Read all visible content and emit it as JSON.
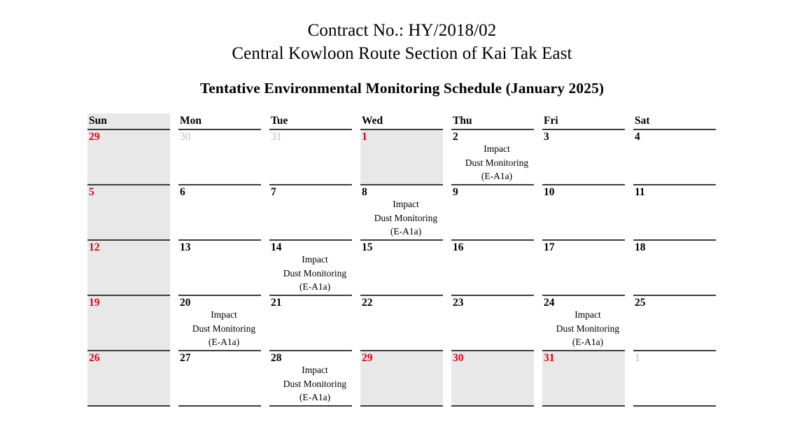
{
  "header": {
    "contract_line": "Contract No.: HY/2018/02",
    "project_line": "Central Kowloon Route Section of Kai Tak East",
    "schedule_title": "Tentative Environmental Monitoring Schedule (January 2025)"
  },
  "colors": {
    "holiday_red": "#e60012",
    "outside_month_gray": "#bdbdbd",
    "shaded_cell": "#e8e8e8",
    "border_dark": "#3b3b3b"
  },
  "calendar": {
    "month_label": "January 2025",
    "daynames": [
      "Sun",
      "Mon",
      "Tue",
      "Wed",
      "Thu",
      "Fri",
      "Sat"
    ],
    "event_label": {
      "line1": "Impact",
      "line2": "Dust Monitoring",
      "line3": "(E-A1a)"
    },
    "weeks": [
      [
        {
          "date": "29",
          "style": "holiday",
          "shaded": true,
          "event": false
        },
        {
          "date": "30",
          "style": "outside",
          "shaded": false,
          "event": false
        },
        {
          "date": "31",
          "style": "outside",
          "shaded": false,
          "event": false
        },
        {
          "date": "1",
          "style": "holiday",
          "shaded": true,
          "event": false
        },
        {
          "date": "2",
          "style": "normal",
          "shaded": false,
          "event": true
        },
        {
          "date": "3",
          "style": "normal",
          "shaded": false,
          "event": false
        },
        {
          "date": "4",
          "style": "normal",
          "shaded": false,
          "event": false
        }
      ],
      [
        {
          "date": "5",
          "style": "holiday",
          "shaded": true,
          "event": false
        },
        {
          "date": "6",
          "style": "normal",
          "shaded": false,
          "event": false
        },
        {
          "date": "7",
          "style": "normal",
          "shaded": false,
          "event": false
        },
        {
          "date": "8",
          "style": "normal",
          "shaded": false,
          "event": true
        },
        {
          "date": "9",
          "style": "normal",
          "shaded": false,
          "event": false
        },
        {
          "date": "10",
          "style": "normal",
          "shaded": false,
          "event": false
        },
        {
          "date": "11",
          "style": "normal",
          "shaded": false,
          "event": false
        }
      ],
      [
        {
          "date": "12",
          "style": "holiday",
          "shaded": true,
          "event": false
        },
        {
          "date": "13",
          "style": "normal",
          "shaded": false,
          "event": false
        },
        {
          "date": "14",
          "style": "normal",
          "shaded": false,
          "event": true
        },
        {
          "date": "15",
          "style": "normal",
          "shaded": false,
          "event": false
        },
        {
          "date": "16",
          "style": "normal",
          "shaded": false,
          "event": false
        },
        {
          "date": "17",
          "style": "normal",
          "shaded": false,
          "event": false
        },
        {
          "date": "18",
          "style": "normal",
          "shaded": false,
          "event": false
        }
      ],
      [
        {
          "date": "19",
          "style": "holiday",
          "shaded": true,
          "event": false
        },
        {
          "date": "20",
          "style": "normal",
          "shaded": false,
          "event": true
        },
        {
          "date": "21",
          "style": "normal",
          "shaded": false,
          "event": false
        },
        {
          "date": "22",
          "style": "normal",
          "shaded": false,
          "event": false
        },
        {
          "date": "23",
          "style": "normal",
          "shaded": false,
          "event": false
        },
        {
          "date": "24",
          "style": "normal",
          "shaded": false,
          "event": true
        },
        {
          "date": "25",
          "style": "normal",
          "shaded": false,
          "event": false
        }
      ],
      [
        {
          "date": "26",
          "style": "holiday",
          "shaded": true,
          "event": false
        },
        {
          "date": "27",
          "style": "normal",
          "shaded": false,
          "event": false
        },
        {
          "date": "28",
          "style": "normal",
          "shaded": false,
          "event": true
        },
        {
          "date": "29",
          "style": "holiday",
          "shaded": true,
          "event": false
        },
        {
          "date": "30",
          "style": "holiday",
          "shaded": true,
          "event": false
        },
        {
          "date": "31",
          "style": "holiday",
          "shaded": true,
          "event": false
        },
        {
          "date": "1",
          "style": "outside",
          "shaded": false,
          "event": false
        }
      ]
    ]
  }
}
